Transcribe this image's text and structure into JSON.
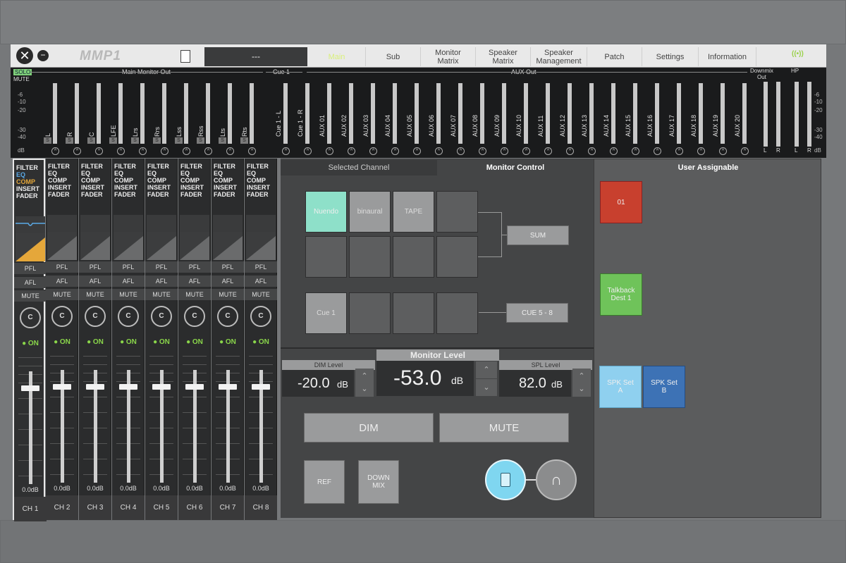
{
  "titlebar": {
    "logo": "MMP1",
    "scene_name": "---",
    "tabs": [
      {
        "label": "Main",
        "active": true
      },
      {
        "label": "Sub"
      },
      {
        "label": "Monitor\nMatrix"
      },
      {
        "label": "Speaker\nMatrix"
      },
      {
        "label": "Speaker\nManagement"
      },
      {
        "label": "Patch"
      },
      {
        "label": "Settings"
      },
      {
        "label": "Information"
      }
    ],
    "link_indicator": "((•))"
  },
  "meters": {
    "solo_label": "SOLO",
    "mute_label": "MUTE",
    "group_main": "Main Monitor Out",
    "group_cue": "Cue 1",
    "group_aux": "AUX Out",
    "group_downmix": "Downmix\nOut",
    "group_hp": "HP",
    "scale_left": [
      "-6",
      "-10",
      "-20",
      "-30",
      "-40",
      "dB"
    ],
    "scale_right": [
      "-6",
      "-10",
      "-20",
      "-30",
      "-40",
      "dB"
    ],
    "main_channels": [
      "L",
      "R",
      "C",
      "LFE",
      "Lrs",
      "Rrs",
      "Lss",
      "Rss",
      "Lts",
      "Rts"
    ],
    "cue_channels": [
      "Cue 1 - L",
      "Cue 1 - R"
    ],
    "aux_channels": [
      "AUX 01",
      "AUX 02",
      "AUX 03",
      "AUX 04",
      "AUX 05",
      "AUX 06",
      "AUX 07",
      "AUX 08",
      "AUX 09",
      "AUX 10",
      "AUX 11",
      "AUX 12",
      "AUX 13",
      "AUX 14",
      "AUX 15",
      "AUX 16",
      "AUX 17",
      "AUX 18",
      "AUX 19",
      "AUX 20"
    ],
    "downmix_channels": [
      "L",
      "R"
    ],
    "hp_channels": [
      "L",
      "R"
    ],
    "s_label": "S"
  },
  "channels": [
    {
      "name": "CH 1",
      "db": "0.0dB",
      "knob": "C",
      "on": "ON",
      "pfl": "PFL",
      "afl": "AFL",
      "mute": "MUTE",
      "selected": true
    },
    {
      "name": "CH 2",
      "db": "0.0dB",
      "knob": "C",
      "on": "ON",
      "pfl": "PFL",
      "afl": "AFL",
      "mute": "MUTE"
    },
    {
      "name": "CH 3",
      "db": "0.0dB",
      "knob": "C",
      "on": "ON",
      "pfl": "PFL",
      "afl": "AFL",
      "mute": "MUTE"
    },
    {
      "name": "CH 4",
      "db": "0.0dB",
      "knob": "C",
      "on": "ON",
      "pfl": "PFL",
      "afl": "AFL",
      "mute": "MUTE"
    },
    {
      "name": "CH 5",
      "db": "0.0dB",
      "knob": "C",
      "on": "ON",
      "pfl": "PFL",
      "afl": "AFL",
      "mute": "MUTE"
    },
    {
      "name": "CH 6",
      "db": "0.0dB",
      "knob": "C",
      "on": "ON",
      "pfl": "PFL",
      "afl": "AFL",
      "mute": "MUTE"
    },
    {
      "name": "CH 7",
      "db": "0.0dB",
      "knob": "C",
      "on": "ON",
      "pfl": "PFL",
      "afl": "AFL",
      "mute": "MUTE"
    },
    {
      "name": "CH 8",
      "db": "0.0dB",
      "knob": "C",
      "on": "ON",
      "pfl": "PFL",
      "afl": "AFL",
      "mute": "MUTE"
    }
  ],
  "processing_labels": [
    "FILTER",
    "EQ",
    "COMP",
    "INSERT",
    "FADER"
  ],
  "monitor": {
    "tab_selected": "Selected Channel",
    "tab_control": "Monitor Control",
    "sources": [
      "Nuendo",
      "binaural",
      "TAPE"
    ],
    "sum_label": "SUM",
    "cue_label": "Cue 1",
    "cue58_label": "CUE 5 - 8",
    "dim_level_label": "DIM Level",
    "dim_level_value": "-20.0",
    "dim_level_unit": "dB",
    "monitor_level_label": "Monitor Level",
    "monitor_level_value": "-53.0",
    "monitor_level_unit": "dB",
    "spl_level_label": "SPL Level",
    "spl_level_value": "82.0",
    "spl_level_unit": "dB",
    "dim_button": "DIM",
    "mute_button": "MUTE",
    "ref_button": "REF",
    "downmix_button": "DOWN\nMIX"
  },
  "user_assignable": {
    "title": "User Assignable",
    "buttons": [
      {
        "label": "01",
        "color": "#c8402e"
      },
      {
        "label": "Talkback\nDest 1",
        "color": "#6fc35a"
      },
      {
        "label": "SPK Set\nA",
        "color": "#8fd0ef"
      },
      {
        "label": "SPK Set\nB",
        "color": "#3d72b5"
      }
    ]
  },
  "colors": {
    "active_tab": "#d9f07a",
    "on_green": "#8ad64a",
    "nuendo_active": "#8ee0c9",
    "speaker_active": "#7fd6f0",
    "comp_fill": "#e5a73a"
  }
}
